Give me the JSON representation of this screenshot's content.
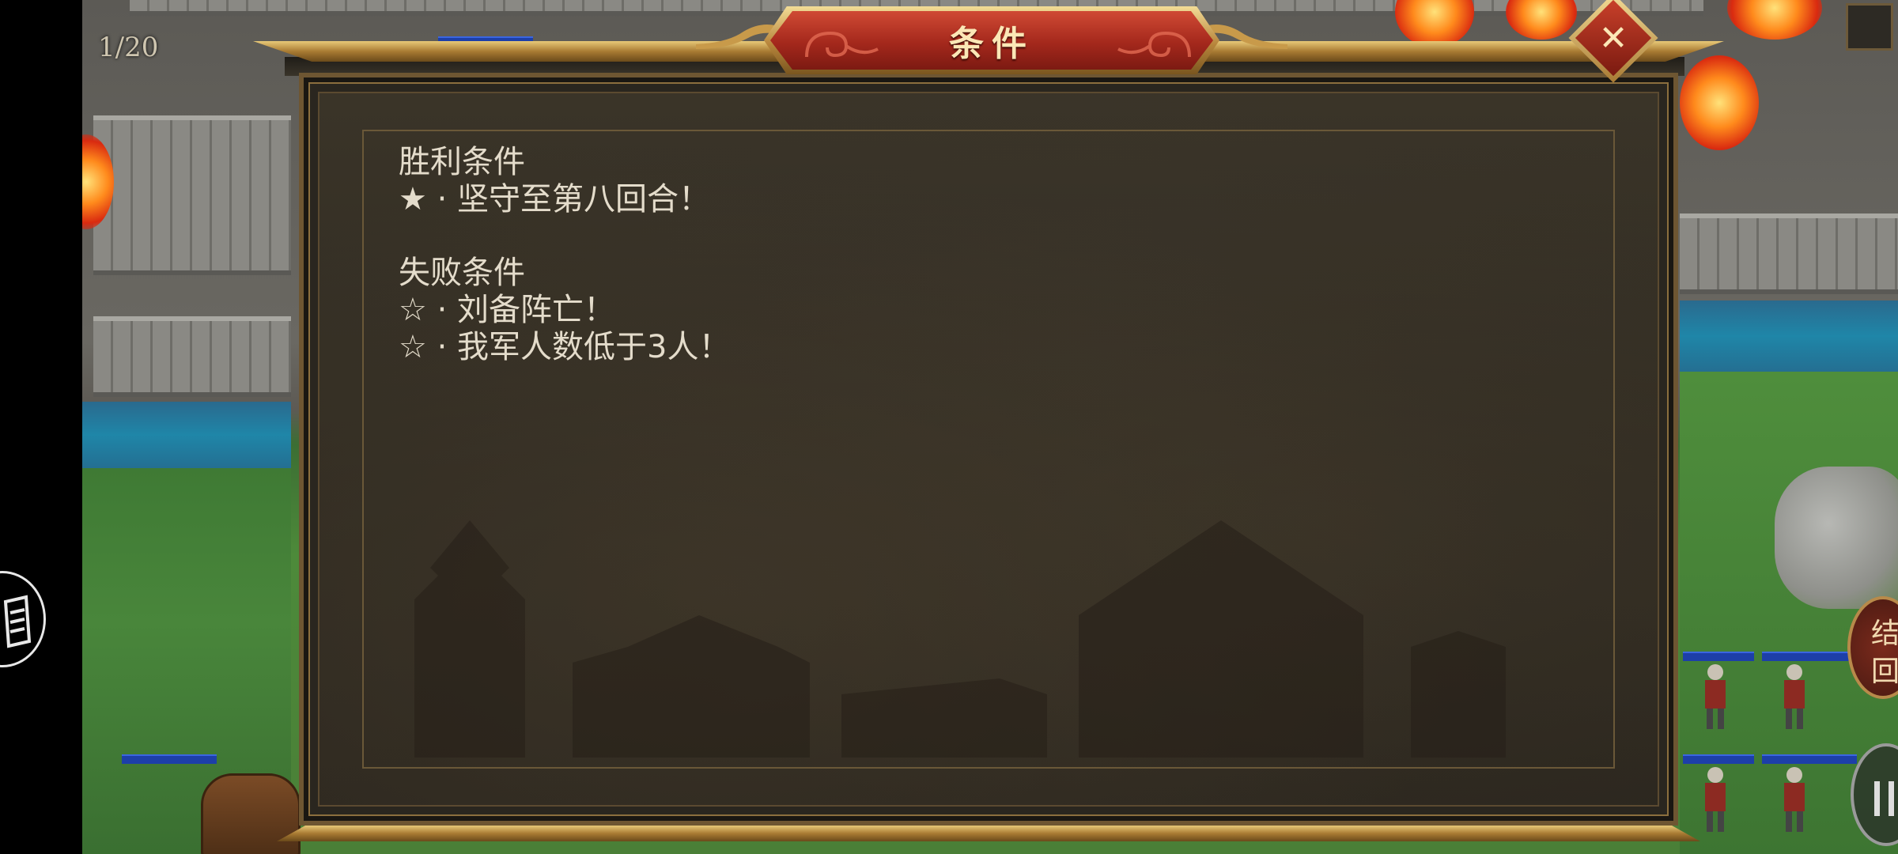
{
  "hud": {
    "turn_counter": "1/20",
    "end_turn_chars": [
      "结",
      "回"
    ]
  },
  "dialog": {
    "title": "条件",
    "victory_heading": "胜利条件",
    "victory_conditions": [
      "★ · 坚守至第八回合！"
    ],
    "defeat_heading": "失败条件",
    "defeat_conditions": [
      "☆ · 刘备阵亡！",
      "☆ · 我军人数低于3人！"
    ]
  },
  "icons": {
    "close": "close-icon",
    "gesture": "gesture-icon",
    "pause": "pause-icon"
  },
  "colors": {
    "title_banner": "#a4281c",
    "gold_trim": "#c89a4a",
    "panel_bg": "#332e25",
    "text": "#e4dccb"
  }
}
